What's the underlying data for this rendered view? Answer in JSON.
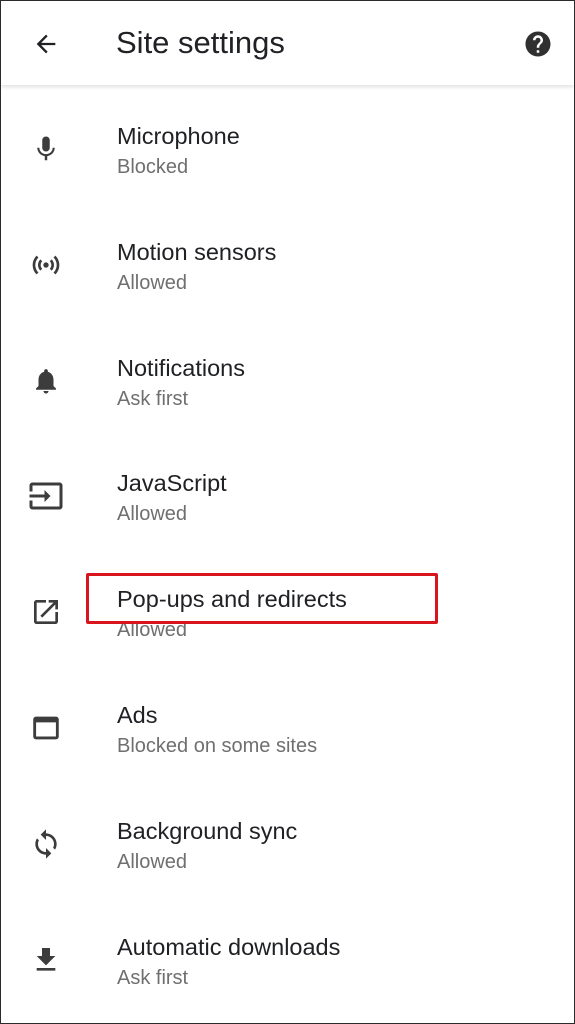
{
  "appbar": {
    "title": "Site settings",
    "back_icon": "arrow-back-icon",
    "help_icon": "help-circle-icon"
  },
  "items": [
    {
      "label": "Microphone",
      "status": "Blocked",
      "icon": "microphone-icon"
    },
    {
      "label": "Motion sensors",
      "status": "Allowed",
      "icon": "motion-sensors-icon"
    },
    {
      "label": "Notifications",
      "status": "Ask first",
      "icon": "bell-icon"
    },
    {
      "label": "JavaScript",
      "status": "Allowed",
      "icon": "javascript-icon"
    },
    {
      "label": "Pop-ups and redirects",
      "status": "Allowed",
      "icon": "open-external-icon"
    },
    {
      "label": "Ads",
      "status": "Blocked on some sites",
      "icon": "ads-window-icon"
    },
    {
      "label": "Background sync",
      "status": "Allowed",
      "icon": "sync-icon"
    },
    {
      "label": "Automatic downloads",
      "status": "Ask first",
      "icon": "download-icon"
    }
  ],
  "colors": {
    "text_primary": "#202124",
    "text_secondary": "#6f6f6f",
    "icon": "#3c3c3c",
    "highlight_box": "#d8141c"
  }
}
